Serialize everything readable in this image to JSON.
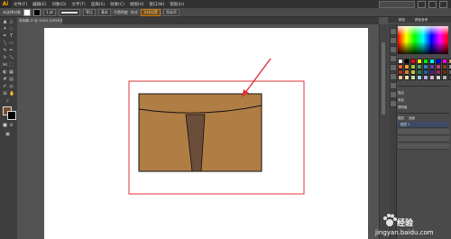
{
  "app": {
    "logo": "Ai"
  },
  "menubar": {
    "items": [
      "文件(F)",
      "编辑(E)",
      "对象(O)",
      "文字(T)",
      "选择(S)",
      "效果(C)",
      "视图(V)",
      "窗口(W)",
      "帮助(H)"
    ],
    "search_placeholder": ""
  },
  "controlbar": {
    "label": "未选择对象",
    "stroke_weight": "1 pt",
    "stroke_style": "等比",
    "brush": "基本",
    "opacity_label": "不透明度",
    "style_label": "样式",
    "doc_setup": "文档设置",
    "prefs": "首选项"
  },
  "document": {
    "tab_title": "未标题-1* @ 100% (CMYK/预览)"
  },
  "colors": {
    "pants_fill": "#B07D44",
    "pocket_fill": "#6B4E3A",
    "outline": "#111111",
    "annotation_red": "#E0303A"
  },
  "panels": {
    "tabs": [
      "颜色",
      "颜色参考"
    ],
    "layers_tabs": [
      "图层",
      "画板"
    ],
    "layer_name": "图层 1",
    "rows": [
      "描边",
      "渐变",
      "透明度"
    ]
  },
  "watermark": {
    "brand": "Bai",
    "text": "经验",
    "url": "jingyan.baidu.com"
  }
}
